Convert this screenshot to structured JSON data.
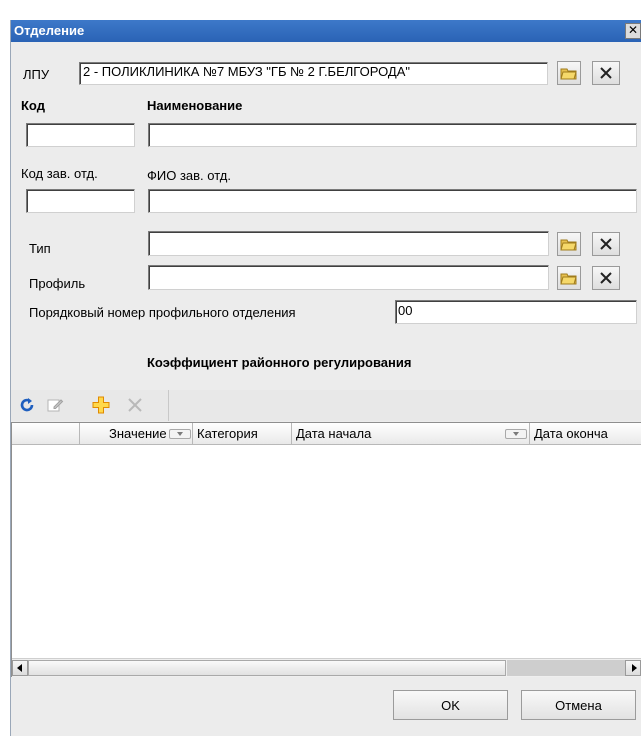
{
  "window": {
    "title": "Отделение",
    "close_icon": "close-icon"
  },
  "lpu": {
    "label": "ЛПУ",
    "value": "2 - ПОЛИКЛИНИКА №7  МБУЗ  \"ГБ  № 2 Г.БЕЛГОРОДА\""
  },
  "code": {
    "label": "Код",
    "value": ""
  },
  "name": {
    "label": "Наименование",
    "value": ""
  },
  "head_code": {
    "label": "Код зав. отд.",
    "value": ""
  },
  "head_fio": {
    "label": "ФИО зав. отд.",
    "value": ""
  },
  "type": {
    "label": "Тип",
    "value": ""
  },
  "profile": {
    "label": "Профиль",
    "value": ""
  },
  "order_number": {
    "label": "Порядковый номер профильного отделения",
    "value": "00"
  },
  "coef_section": {
    "title": "Коэффициент районного регулирования"
  },
  "toolbar": {
    "icons": [
      "refresh-icon",
      "edit-icon",
      "add-icon",
      "delete-icon"
    ]
  },
  "grid": {
    "columns": [
      "",
      "Значение",
      "Категория",
      "Дата начала",
      "Дата оконча"
    ],
    "rows": []
  },
  "buttons": {
    "ok": "OK",
    "cancel": "Отмена"
  },
  "colors": {
    "title_bar": "#2a63b5",
    "add_icon": "#f0a000",
    "refresh_icon": "#1f5fbf"
  }
}
